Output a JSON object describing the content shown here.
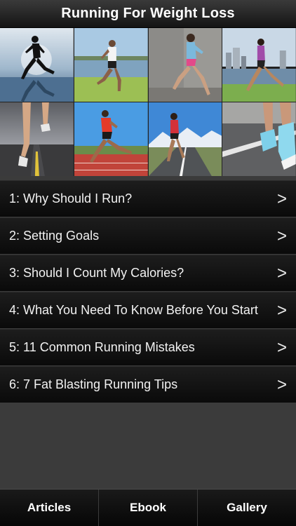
{
  "header": {
    "title": "Running For Weight Loss"
  },
  "photos": [
    {
      "icon": "runner-silhouette-sunset-photo"
    },
    {
      "icon": "runner-by-lake-photo"
    },
    {
      "icon": "runner-by-wall-photo"
    },
    {
      "icon": "runner-city-waterfront-photo"
    },
    {
      "icon": "legs-on-road-stormy-photo"
    },
    {
      "icon": "runner-red-shirt-track-photo"
    },
    {
      "icon": "runner-mountain-road-photo"
    },
    {
      "icon": "running-shoes-closeup-photo"
    }
  ],
  "menu": {
    "items": [
      {
        "label": "1: Why Should I Run?",
        "chevron": ">"
      },
      {
        "label": "2: Setting Goals",
        "chevron": ">"
      },
      {
        "label": "3: Should I Count My Calories?",
        "chevron": ">"
      },
      {
        "label": "4: What You Need To Know Before You Start",
        "chevron": ">"
      },
      {
        "label": "5: 11 Common Running Mistakes",
        "chevron": ">"
      },
      {
        "label": "6: 7 Fat Blasting Running Tips",
        "chevron": ">"
      }
    ]
  },
  "tabs": [
    {
      "label": "Articles"
    },
    {
      "label": "Ebook"
    },
    {
      "label": "Gallery"
    }
  ],
  "colors": {
    "background": "#3b3b3b",
    "bar_dark": "#0a0a0a",
    "text": "#ffffff"
  }
}
